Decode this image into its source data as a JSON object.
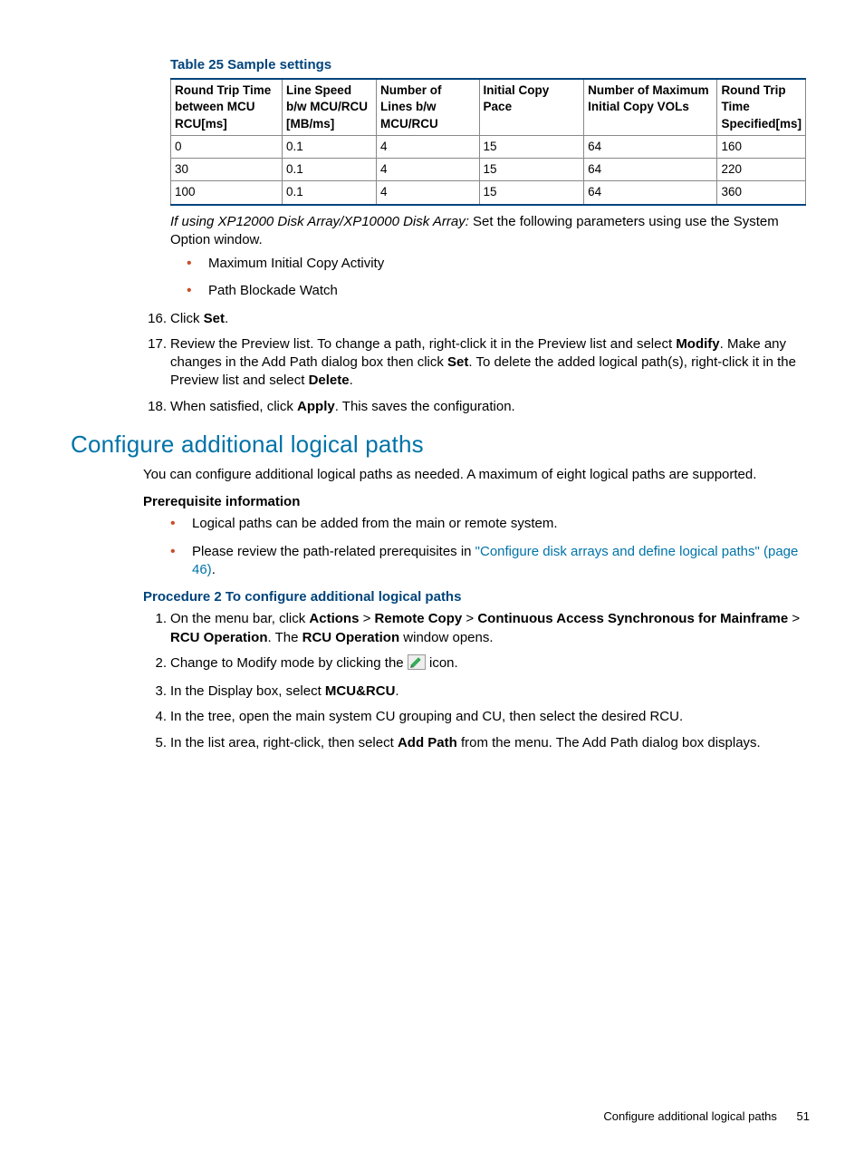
{
  "table": {
    "caption": "Table 25 Sample settings",
    "headers": [
      "Round Trip Time between MCU RCU[ms]",
      "Line Speed b/w MCU/RCU [MB/ms]",
      "Number of Lines b/w MCU/RCU",
      "Initial Copy Pace",
      "Number of Maximum Initial Copy VOLs",
      "Round Trip Time Specified[ms]"
    ],
    "rows": [
      [
        "0",
        "0.1",
        "4",
        "15",
        "64",
        "160"
      ],
      [
        "30",
        "0.1",
        "4",
        "15",
        "64",
        "220"
      ],
      [
        "100",
        "0.1",
        "4",
        "15",
        "64",
        "360"
      ]
    ]
  },
  "xp_note": {
    "lead_italic": "If using XP12000 Disk Array/XP10000 Disk Array:",
    "rest": " Set the following parameters using use the System Option window."
  },
  "xp_bullets": [
    "Maximum Initial Copy Activity",
    "Path Blockade Watch"
  ],
  "steps_a": [
    {
      "n": "16.",
      "pre": "Click ",
      "b1": "Set",
      "post": "."
    },
    {
      "n": "17.",
      "pre": "Review the Preview list. To change a path, right-click it in the Preview list and select ",
      "b1": "Modify",
      "mid1": ". Make any changes in the Add Path dialog box then click ",
      "b2": "Set",
      "mid2": ". To delete the added logical path(s), right-click it in the Preview list and select ",
      "b3": "Delete",
      "post": "."
    },
    {
      "n": "18.",
      "pre": "When satisfied, click ",
      "b1": "Apply",
      "post": ". This saves the configuration."
    }
  ],
  "section_heading": "Configure additional logical paths",
  "section_intro": "You can configure additional logical paths as needed. A maximum of eight logical paths are supported.",
  "prereq_head": "Prerequisite information",
  "prereq_bullets": [
    {
      "text": "Logical paths can be added from the main or remote system."
    },
    {
      "pre": "Please review the path-related prerequisites in ",
      "link": "\"Configure disk arrays and define logical paths\" (page 46)",
      "post": "."
    }
  ],
  "proc_title": "Procedure 2 To configure additional logical paths",
  "steps_b": {
    "s1": {
      "n": "1.",
      "pre": "On the menu bar, click ",
      "b1": "Actions",
      "gt1": " > ",
      "b2": "Remote Copy",
      "gt2": " > ",
      "b3": "Continuous Access Synchronous for Mainframe",
      "gt3": " > ",
      "b4": "RCU Operation",
      "mid": ". The ",
      "b5": "RCU Operation",
      "post": " window opens."
    },
    "s2": {
      "n": "2.",
      "pre": "Change to Modify mode by clicking the ",
      "post": " icon."
    },
    "s3": {
      "n": "3.",
      "pre": "In the Display box, select ",
      "b1": "MCU&RCU",
      "post": "."
    },
    "s4": {
      "n": "4.",
      "text": "In the tree, open the main system CU grouping and CU, then select the desired RCU."
    },
    "s5": {
      "n": "5.",
      "pre": "In the list area, right-click, then select ",
      "b1": "Add Path",
      "post": " from the menu. The Add Path dialog box displays."
    }
  },
  "footer": {
    "text": "Configure additional logical paths",
    "page": "51"
  }
}
